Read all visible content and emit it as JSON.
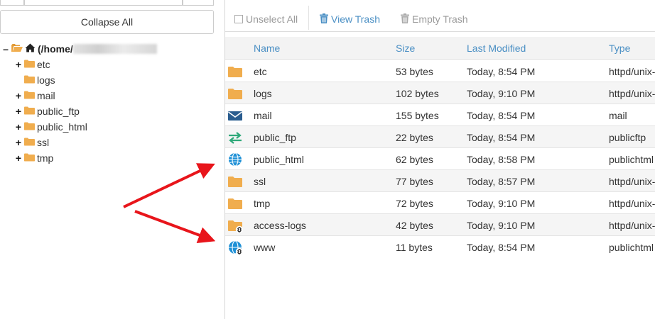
{
  "left": {
    "collapse_label": "Collapse All",
    "tree": {
      "root_label": "(/home/",
      "items": [
        {
          "label": "etc",
          "toggle": "+"
        },
        {
          "label": "logs",
          "toggle": ""
        },
        {
          "label": "mail",
          "toggle": "+"
        },
        {
          "label": "public_ftp",
          "toggle": "+"
        },
        {
          "label": "public_html",
          "toggle": "+"
        },
        {
          "label": "ssl",
          "toggle": "+"
        },
        {
          "label": "tmp",
          "toggle": "+"
        }
      ]
    }
  },
  "toolbar": {
    "unselect_all": "Unselect All",
    "view_trash": "View Trash",
    "empty_trash": "Empty Trash"
  },
  "table": {
    "headers": {
      "name": "Name",
      "size": "Size",
      "modified": "Last Modified",
      "type": "Type"
    },
    "rows": [
      {
        "icon": "folder-icon",
        "name": "etc",
        "size": "53 bytes",
        "modified": "Today, 8:54 PM",
        "type": "httpd/unix-"
      },
      {
        "icon": "folder-icon",
        "name": "logs",
        "size": "102 bytes",
        "modified": "Today, 9:10 PM",
        "type": "httpd/unix-"
      },
      {
        "icon": "envelope-icon",
        "name": "mail",
        "size": "155 bytes",
        "modified": "Today, 8:54 PM",
        "type": "mail"
      },
      {
        "icon": "transfer-arrows-icon",
        "name": "public_ftp",
        "size": "22 bytes",
        "modified": "Today, 8:54 PM",
        "type": "publicftp"
      },
      {
        "icon": "globe-icon",
        "name": "public_html",
        "size": "62 bytes",
        "modified": "Today, 8:58 PM",
        "type": "publichtml"
      },
      {
        "icon": "folder-icon",
        "name": "ssl",
        "size": "77 bytes",
        "modified": "Today, 8:57 PM",
        "type": "httpd/unix-"
      },
      {
        "icon": "folder-icon",
        "name": "tmp",
        "size": "72 bytes",
        "modified": "Today, 9:10 PM",
        "type": "httpd/unix-"
      },
      {
        "icon": "folder-link-icon",
        "name": "access-logs",
        "size": "42 bytes",
        "modified": "Today, 9:10 PM",
        "type": "httpd/unix-"
      },
      {
        "icon": "globe-link-icon",
        "name": "www",
        "size": "11 bytes",
        "modified": "Today, 8:54 PM",
        "type": "publichtml"
      }
    ]
  },
  "colors": {
    "accent": "#4a8fc4",
    "folder": "#f0ad4e",
    "arrow": "#e8151b"
  }
}
